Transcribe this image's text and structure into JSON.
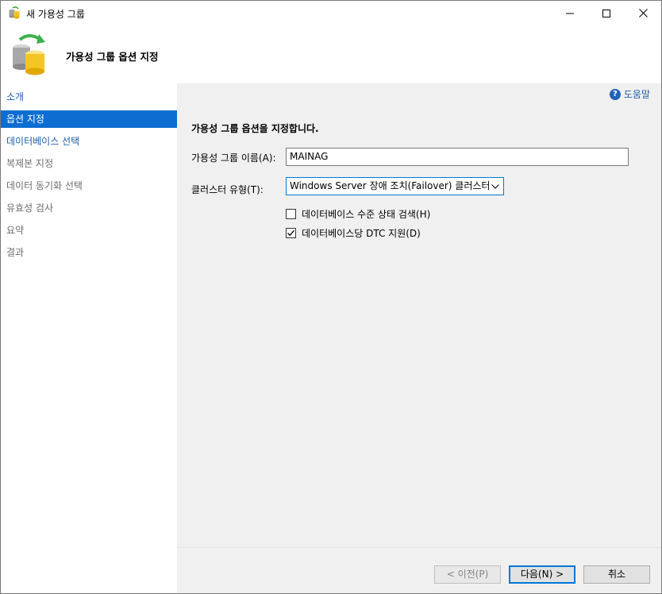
{
  "window": {
    "title": "새 가용성 그룹",
    "heading": "가용성 그룹 옵션 지정"
  },
  "nav": {
    "items": [
      {
        "label": "소개",
        "state": "link"
      },
      {
        "label": "옵션 지정",
        "state": "selected"
      },
      {
        "label": "데이터베이스 선택",
        "state": "link"
      },
      {
        "label": "복제본 지정",
        "state": "disabled"
      },
      {
        "label": "데이터 동기화 선택",
        "state": "disabled"
      },
      {
        "label": "유효성 검사",
        "state": "disabled"
      },
      {
        "label": "요약",
        "state": "disabled"
      },
      {
        "label": "결과",
        "state": "disabled"
      }
    ]
  },
  "content": {
    "help_label": "도움말",
    "intro": "가용성 그룹 옵션을 지정합니다.",
    "name_label": "가용성 그룹 이름(A):",
    "name_value": "MAINAG",
    "cluster_label": "클러스터 유형(T):",
    "cluster_value": "Windows Server 장애 조치(Failover) 클러스터",
    "health_check_label": "데이터베이스 수준 상태 검색(H)",
    "health_check_checked": false,
    "dtc_label": "데이터베이스당 DTC 지원(D)",
    "dtc_checked": true
  },
  "footer": {
    "prev_label": "< 이전(P)",
    "next_label": "다음(N) >",
    "cancel_label": "취소"
  },
  "colors": {
    "selected_bg": "#0d6dd1",
    "link": "#1f5ea8",
    "focus_border": "#0078d7"
  }
}
